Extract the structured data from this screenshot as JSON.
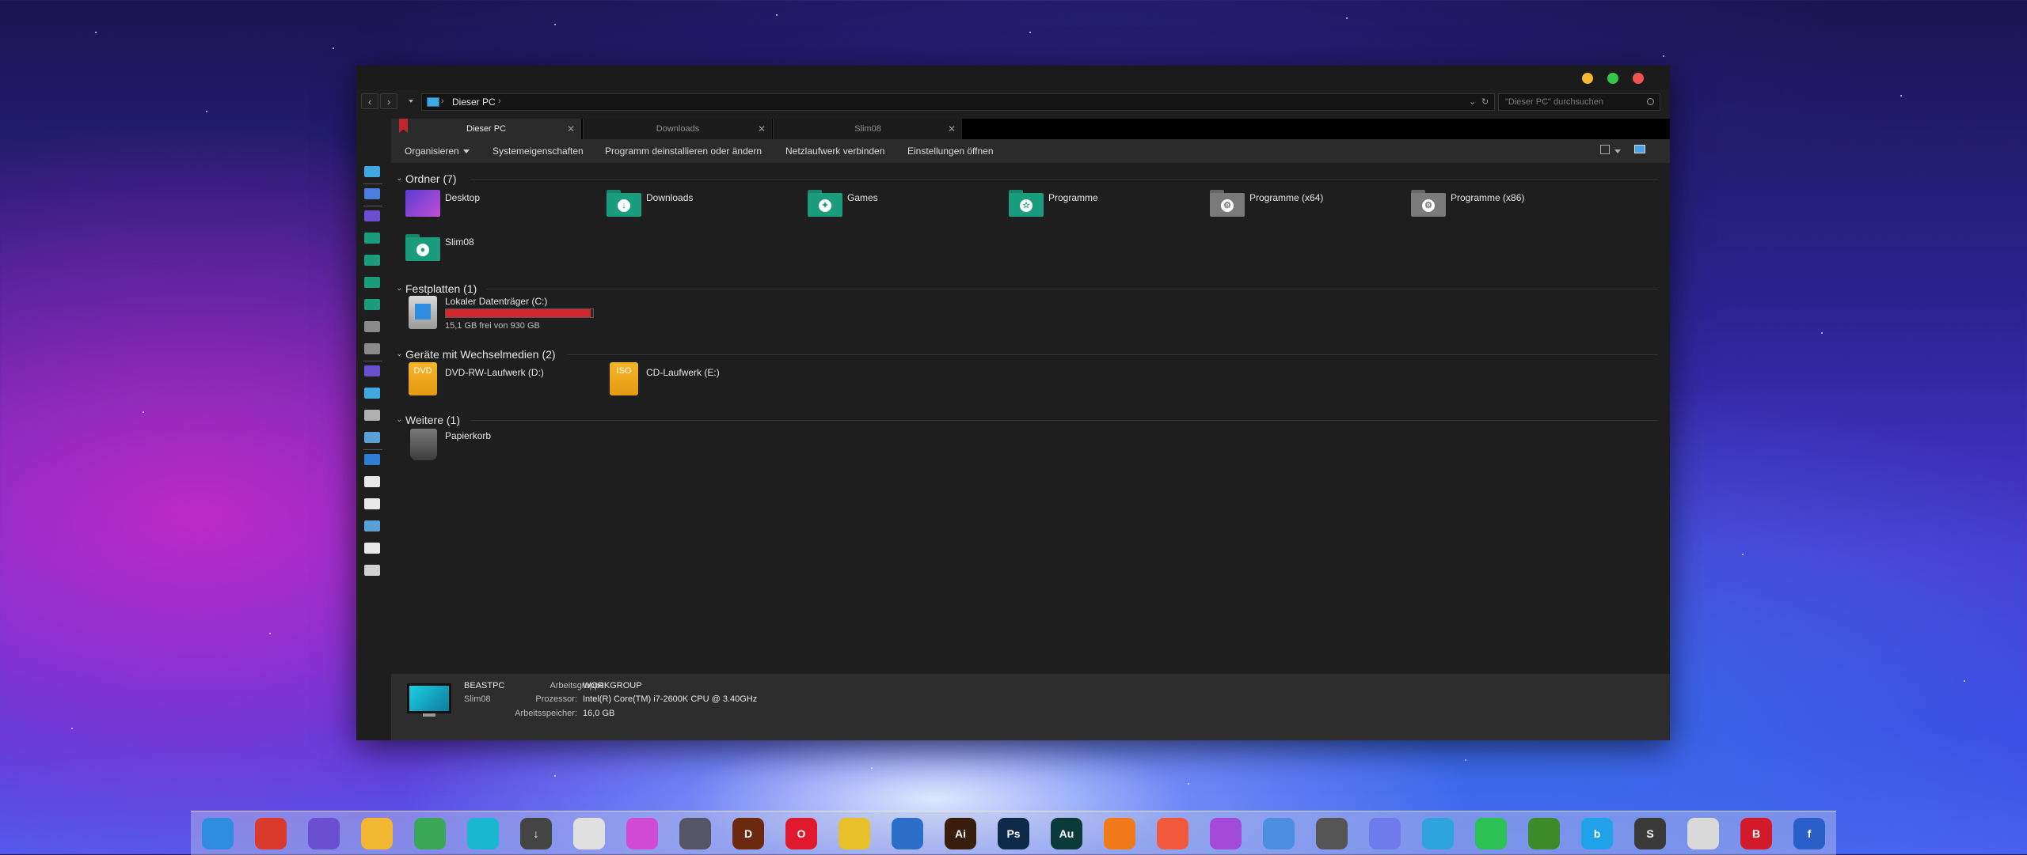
{
  "window": {
    "address": {
      "crumb": "Dieser PC"
    },
    "search": {
      "placeholder": "\"Dieser PC\" durchsuchen"
    },
    "tabs": [
      {
        "label": "Dieser PC",
        "active": true
      },
      {
        "label": "Downloads",
        "active": false
      },
      {
        "label": "Slim08",
        "active": false
      }
    ],
    "toolbar": {
      "organize": "Organisieren",
      "system_properties": "Systemeigenschaften",
      "uninstall": "Programm deinstallieren oder ändern",
      "map_drive": "Netzlaufwerk verbinden",
      "open_settings": "Einstellungen öffnen"
    },
    "groups": {
      "folders": {
        "header": "Ordner (7)",
        "items": [
          {
            "label": "Desktop",
            "icon": "desktop-folder-icon",
            "color": "#6a3fd1"
          },
          {
            "label": "Downloads",
            "icon": "download-folder-icon",
            "color": "#1b9c7c"
          },
          {
            "label": "Games",
            "icon": "games-folder-icon",
            "color": "#1b9c7c"
          },
          {
            "label": "Programme",
            "icon": "star-folder-icon",
            "color": "#1b9c7c"
          },
          {
            "label": "Programme (x64)",
            "icon": "gear-folder-icon",
            "color": "#7a7a7a"
          },
          {
            "label": "Programme (x86)",
            "icon": "gear-folder-icon",
            "color": "#7a7a7a"
          },
          {
            "label": "Slim08",
            "icon": "user-folder-icon",
            "color": "#1b9c7c"
          }
        ]
      },
      "drives": {
        "header": "Festplatten (1)",
        "items": [
          {
            "label": "Lokaler Datenträger (C:)",
            "free_text": "15,1 GB frei von 930 GB",
            "used_fraction": 0.984
          }
        ]
      },
      "removable": {
        "header": "Geräte mit Wechselmedien (2)",
        "items": [
          {
            "label": "DVD-RW-Laufwerk (D:)",
            "badge": "DVD"
          },
          {
            "label": "CD-Laufwerk (E:)",
            "badge": "ISO"
          }
        ]
      },
      "other": {
        "header": "Weitere (1)",
        "items": [
          {
            "label": "Papierkorb"
          }
        ]
      }
    },
    "details": {
      "computer_name": "BEASTPC",
      "user": "Slim08",
      "workgroup_label": "Arbeitsgruppe:",
      "workgroup": "WORKGROUP",
      "processor_label": "Prozessor:",
      "processor": "Intel(R) Core(TM) i7-2600K CPU @ 3.40GHz",
      "memory_label": "Arbeitsspeicher:",
      "memory": "16,0 GB"
    }
  },
  "dock": {
    "items": [
      {
        "name": "finder-icon",
        "glyph": "",
        "color": "#2f8de0"
      },
      {
        "name": "photo-booth-icon",
        "glyph": "",
        "color": "#d93a2c"
      },
      {
        "name": "desktop-icon",
        "glyph": "",
        "color": "#6a4fd0"
      },
      {
        "name": "folder-icon",
        "glyph": "",
        "color": "#f3b630"
      },
      {
        "name": "google-drive-icon",
        "glyph": "",
        "color": "#3aa757"
      },
      {
        "name": "computer-icon",
        "glyph": "",
        "color": "#1ab7d2"
      },
      {
        "name": "downloads-icon",
        "glyph": "↓",
        "color": "#444"
      },
      {
        "name": "gamepad-icon",
        "glyph": "",
        "color": "#e0e0e0"
      },
      {
        "name": "picasa-icon",
        "glyph": "",
        "color": "#d04ad6"
      },
      {
        "name": "starcraft-icon",
        "glyph": "",
        "color": "#556"
      },
      {
        "name": "diablo-icon",
        "glyph": "D",
        "color": "#6b2a10"
      },
      {
        "name": "opera-icon",
        "glyph": "O",
        "color": "#e0192f"
      },
      {
        "name": "chrome-icon",
        "glyph": "",
        "color": "#e8c12a"
      },
      {
        "name": "thunderbird-icon",
        "glyph": "",
        "color": "#2c6fc8"
      },
      {
        "name": "illustrator-icon",
        "glyph": "Ai",
        "color": "#3a1e0c"
      },
      {
        "name": "photoshop-icon",
        "glyph": "Ps",
        "color": "#0e2a4a"
      },
      {
        "name": "audition-icon",
        "glyph": "Au",
        "color": "#0a3b3a"
      },
      {
        "name": "virtualbox-icon",
        "glyph": "",
        "color": "#f07a1a"
      },
      {
        "name": "activity-icon",
        "glyph": "",
        "color": "#f05a3a"
      },
      {
        "name": "paint-icon",
        "glyph": "",
        "color": "#a34ad8"
      },
      {
        "name": "safari-icon",
        "glyph": "",
        "color": "#4a8fe0"
      },
      {
        "name": "speedometer-icon",
        "glyph": "",
        "color": "#555"
      },
      {
        "name": "discord-icon",
        "glyph": "",
        "color": "#6f7bea"
      },
      {
        "name": "telegram-icon",
        "glyph": "",
        "color": "#2fa3de"
      },
      {
        "name": "whatsapp-icon",
        "glyph": "",
        "color": "#2bc154"
      },
      {
        "name": "globe-icon",
        "glyph": "",
        "color": "#3d8a2a"
      },
      {
        "name": "bing-icon",
        "glyph": "b",
        "color": "#1fa2e8"
      },
      {
        "name": "sublime-icon",
        "glyph": "S",
        "color": "#3a3a3a"
      },
      {
        "name": "calculator-icon",
        "glyph": "",
        "color": "#d9d9d9"
      },
      {
        "name": "bitdefender-icon",
        "glyph": "B",
        "color": "#d31a2a"
      },
      {
        "name": "fedora-icon",
        "glyph": "f",
        "color": "#2a5ec8"
      }
    ]
  }
}
